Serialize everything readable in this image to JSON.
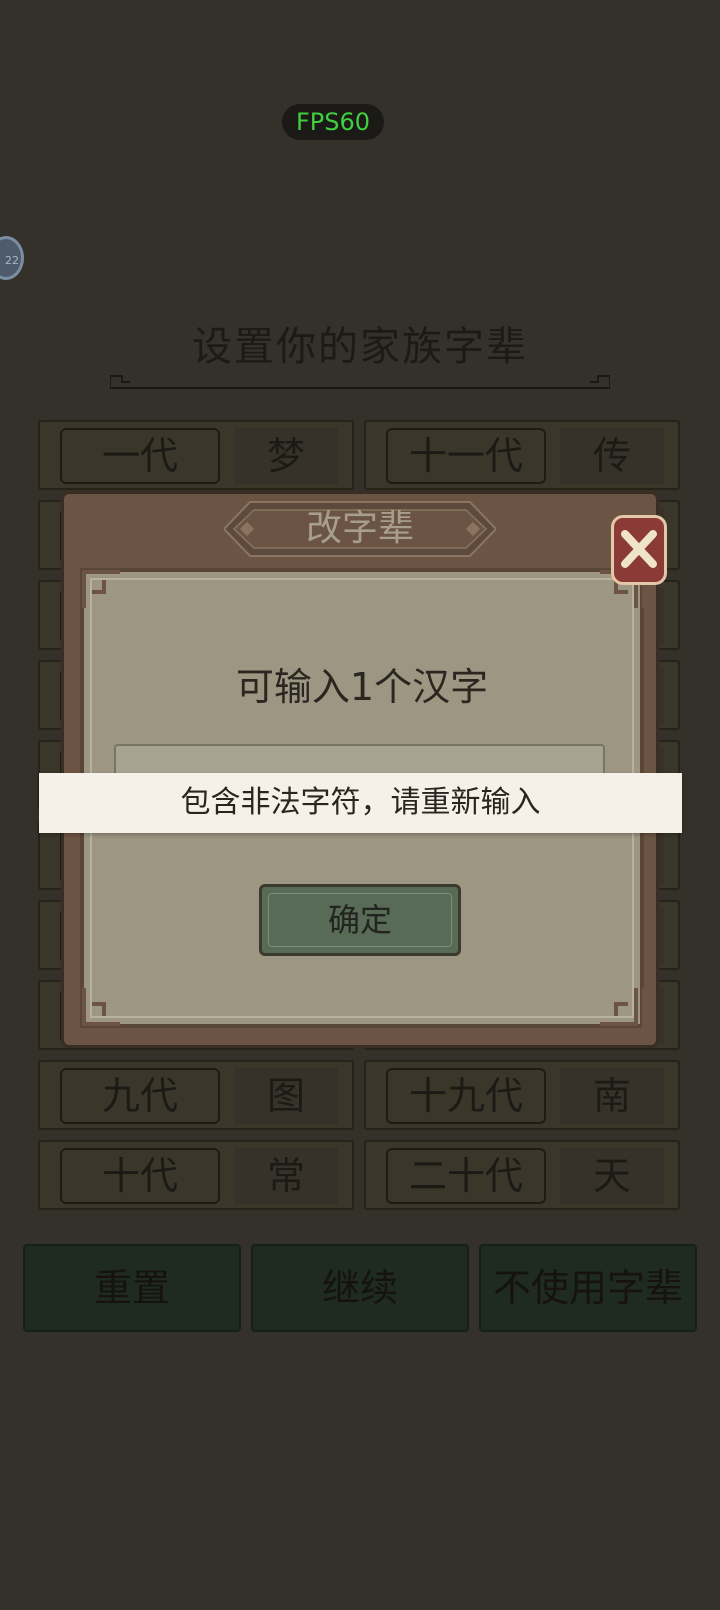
{
  "status": {
    "fps": "FPS60",
    "float_badge": "22"
  },
  "page": {
    "title": "设置你的家族字辈"
  },
  "generations_left": [
    {
      "label": "一代",
      "char": "梦"
    },
    {
      "label": "",
      "char": ""
    },
    {
      "label": "",
      "char": ""
    },
    {
      "label": "",
      "char": ""
    },
    {
      "label": "",
      "char": ""
    },
    {
      "label": "",
      "char": ""
    },
    {
      "label": "",
      "char": ""
    },
    {
      "label": "",
      "char": ""
    },
    {
      "label": "九代",
      "char": "图"
    },
    {
      "label": "十代",
      "char": "常"
    }
  ],
  "generations_right": [
    {
      "label": "十一代",
      "char": "传"
    },
    {
      "label": "",
      "char": ""
    },
    {
      "label": "",
      "char": ""
    },
    {
      "label": "",
      "char": ""
    },
    {
      "label": "",
      "char": ""
    },
    {
      "label": "",
      "char": ""
    },
    {
      "label": "",
      "char": ""
    },
    {
      "label": "",
      "char": ""
    },
    {
      "label": "十九代",
      "char": "南"
    },
    {
      "label": "二十代",
      "char": "天"
    }
  ],
  "bottom_buttons": {
    "reset": "重置",
    "continue": "继续",
    "no_generation_names": "不使用字辈"
  },
  "dialog": {
    "title": "改字辈",
    "hint": "可输入1个汉字",
    "input_value": "",
    "confirm": "确定"
  },
  "toast": {
    "message": "包含非法字符，请重新输入"
  },
  "colors": {
    "background": "#34312a",
    "dialog_frame": "#6b5443",
    "dialog_panel": "#9c9682",
    "confirm_button": "#586b56",
    "close_button": "#8a3b36",
    "fps_text": "#3fcf3f",
    "toast_bg": "#f6f1e8"
  }
}
